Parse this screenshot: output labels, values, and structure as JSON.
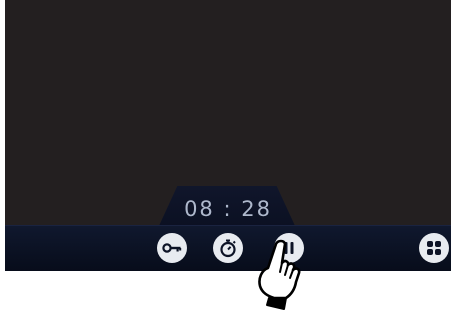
{
  "timer": {
    "display": "08 : 28"
  },
  "controls": [
    {
      "icon": "key-icon"
    },
    {
      "icon": "stopwatch-icon"
    },
    {
      "icon": "pause-icon"
    },
    {
      "icon": "apps-grid-icon"
    }
  ],
  "colors": {
    "screen_bg": "#231f20",
    "bar_bg": "#0b1022",
    "timer_text": "#aeb8cc",
    "button_bg": "#e8ebf0",
    "icon": "#0d1326"
  }
}
